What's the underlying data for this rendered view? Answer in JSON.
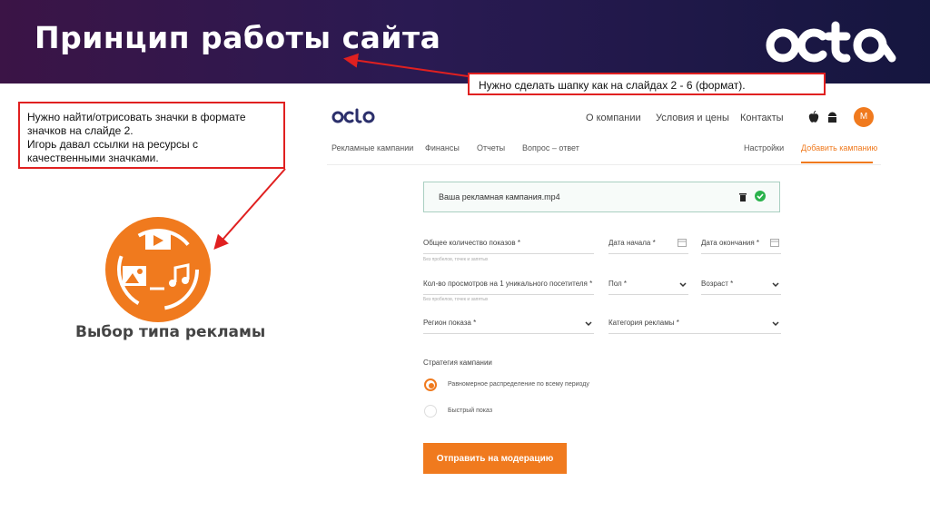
{
  "slide": {
    "title": "Принцип работы сайта",
    "brand_logo_icon": "octa-logo",
    "colors": {
      "header_start": "#3b1446",
      "header_end": "#15163f",
      "accent": "#f07a1e",
      "annotation": "#e02020"
    }
  },
  "annotations": {
    "top_note": "Нужно сделать шапку как на слайдах 2 - 6 (формат).",
    "left_note": "Нужно найти/отрисовать значки в формате значков на слайде 2.\nИгорь давал ссылки на ресурсы с качественными значками."
  },
  "feature": {
    "icon": "ad-type-icon",
    "caption": "Выбор типа рекламы"
  },
  "site": {
    "logo_icon": "octa-logo",
    "top_nav": [
      "О компании",
      "Условия и цены",
      "Контакты"
    ],
    "platform_icons": [
      "apple-icon",
      "android-icon"
    ],
    "avatar_letter": "M",
    "sub_nav": [
      "Рекламные кампании",
      "Финансы",
      "Отчеты",
      "Вопрос – ответ"
    ],
    "settings_label": "Настройки",
    "add_campaign_label": "Добавить кампанию",
    "file": {
      "name": "Ваша рекламная кампания.mp4",
      "icons": [
        "trash-icon",
        "check-icon"
      ]
    },
    "form": {
      "impressions_label": "Общее количество показов *",
      "impressions_hint": "Без пробелов, точек и запятых",
      "start_label": "Дата начала *",
      "end_label": "Дата окончания *",
      "views_label": "Кол-во просмотров на 1 уникального посетителя *",
      "views_hint": "Без пробелов, точек и запятых",
      "gender_label": "Пол *",
      "age_label": "Возраст *",
      "region_label": "Регион показа *",
      "category_label": "Категория рекламы *"
    },
    "strategy": {
      "title": "Стратегия кампании",
      "options": [
        "Равномерное распределение по всему периоду",
        "Быстрый показ"
      ],
      "selected": 0
    },
    "submit_label": "Отправить на модерацию"
  }
}
